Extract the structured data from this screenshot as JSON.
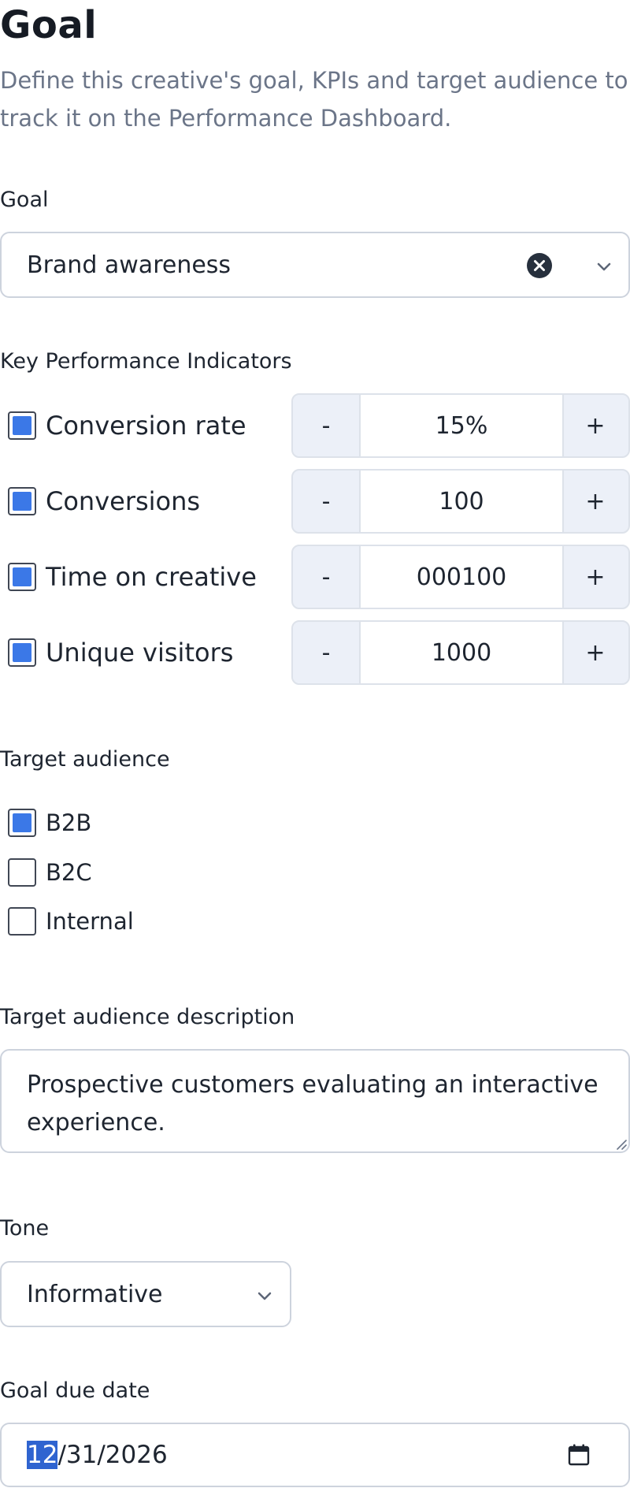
{
  "header": {
    "title": "Goal",
    "description": "Define this creative's goal, KPIs and target audience to track it on the Performance Dashboard."
  },
  "goal": {
    "label": "Goal",
    "selected": "Brand awareness",
    "clear_icon": "clear-icon",
    "dropdown_icon": "chevron-down-icon"
  },
  "kpis": {
    "label": "Key Performance Indicators",
    "decrement_label": "-",
    "increment_label": "+",
    "items": [
      {
        "label": "Conversion rate",
        "value": "15%",
        "checked": true
      },
      {
        "label": "Conversions",
        "value": "100",
        "checked": true
      },
      {
        "label": "Time on creative",
        "value": "000100",
        "checked": true
      },
      {
        "label": "Unique visitors",
        "value": "1000",
        "checked": true
      }
    ]
  },
  "audience": {
    "label": "Target audience",
    "options": [
      {
        "label": "B2B",
        "checked": true
      },
      {
        "label": "B2C",
        "checked": false
      },
      {
        "label": "Internal",
        "checked": false
      }
    ]
  },
  "audience_description": {
    "label": "Target audience description",
    "value": "Prospective customers evaluating an interactive experience."
  },
  "tone": {
    "label": "Tone",
    "selected": "Informative",
    "dropdown_icon": "chevron-down-icon"
  },
  "due_date": {
    "label": "Goal due date",
    "month": "12",
    "rest": "/31/2026",
    "calendar_icon": "calendar-icon"
  },
  "colors": {
    "checkbox_accent": "#3b78e7",
    "date_selection": "#2f64d0",
    "muted_text": "#6b7588",
    "stepper_background": "#ecf0f8"
  }
}
